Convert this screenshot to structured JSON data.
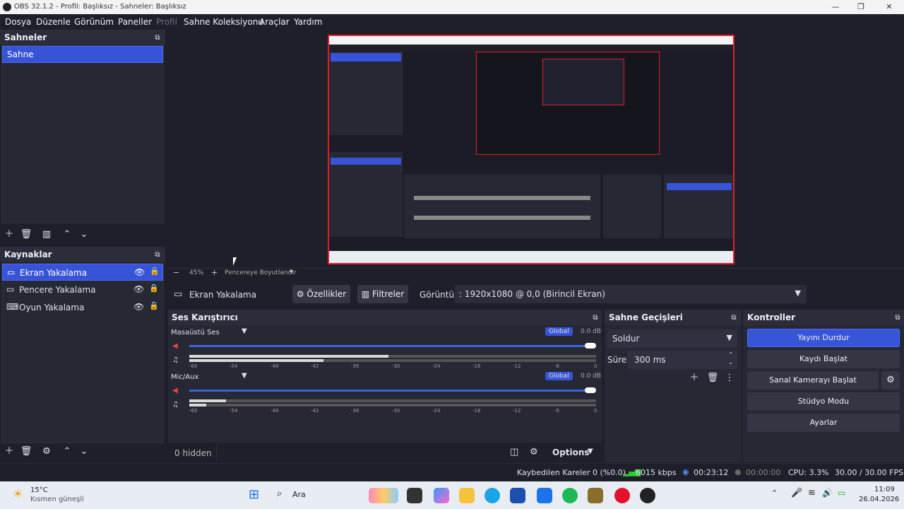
{
  "window": {
    "title": "OBS 32.1.2 - Profil: Başlıksız - Sahneler: Başlıksız",
    "minimize": "—",
    "maximize": "❐",
    "close": "✕"
  },
  "menu": [
    "Dosya",
    "Düzenle",
    "Görünüm",
    "Paneller",
    "Profil",
    "Sahne Koleksiyonu",
    "Araçlar",
    "Yardım"
  ],
  "scenes": {
    "title": "Sahneler",
    "items": [
      "Sahne"
    ]
  },
  "sources": {
    "title": "Kaynaklar",
    "items": [
      "Ekran Yakalama",
      "Pencere Yakalama",
      "Oyun Yakalama"
    ]
  },
  "preview": {
    "zoom": "45%",
    "resize_label": "Pencereye Boyutlandır",
    "minus": "−",
    "plus": "+"
  },
  "source_toolbar": {
    "source_name": "Ekran Yakalama",
    "properties": "Özellikler",
    "filters": "Filtreler",
    "display_label": "Görüntü",
    "display_value": ": 1920x1080 @ 0,0 (Birincil Ekran)"
  },
  "mixer": {
    "title": "Ses Karıştırıcı",
    "channels": [
      {
        "name": "Masaüstü Ses",
        "badge": "Global",
        "db": "0.0 dB"
      },
      {
        "name": "Mic/Aux",
        "badge": "Global",
        "db": "0.0 dB"
      }
    ],
    "ticks": [
      "-60",
      "-54",
      "-48",
      "-42",
      "-36",
      "-30",
      "-24",
      "-18",
      "-12",
      "-6",
      "0"
    ],
    "hidden": "0 hidden",
    "options": "Options"
  },
  "transitions": {
    "title": "Sahne Geçişleri",
    "type": "Soldur",
    "duration_label": "Süre",
    "duration_value": "300 ms"
  },
  "controls": {
    "title": "Kontroller",
    "stop_stream": "Yayını Durdur",
    "start_record": "Kaydı Başlat",
    "start_vcam": "Sanal Kamerayı Başlat",
    "studio_mode": "Stüdyo Modu",
    "settings": "Ayarlar"
  },
  "status": {
    "dropped": "Kaybedilen Kareler 0 (%0.0)",
    "bitrate": "6015 kbps",
    "stream_time": "00:23:12",
    "record_time": "00:00:00",
    "cpu": "CPU: 3.3%",
    "fps": "30.00 / 30.00 FPS"
  },
  "taskbar": {
    "temp": "15°C",
    "weather": "Kısmen güneşli",
    "search": "Ara",
    "time": "11:09",
    "date": "26.04.2026"
  },
  "colors": {
    "accent": "#3753d6",
    "preview_border": "#e11d2a",
    "bg": "#1e1f29"
  }
}
